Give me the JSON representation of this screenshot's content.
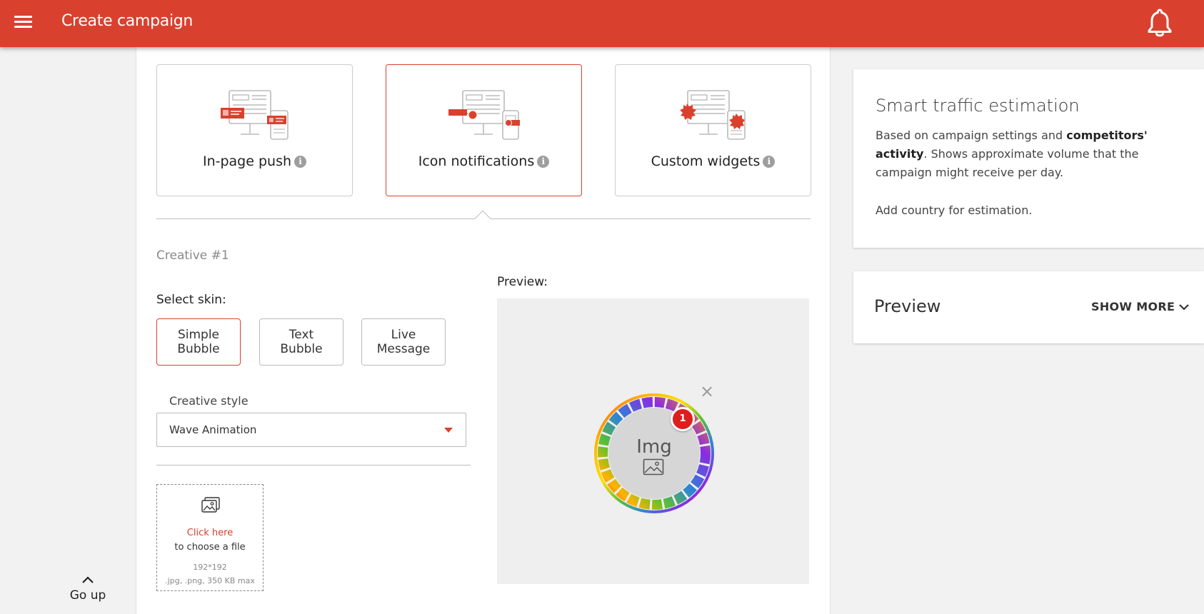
{
  "header": {
    "title": "Create campaign",
    "menu_icon": "hamburger-menu-icon",
    "bell_icon": "bell-icon",
    "color": "#d9412e"
  },
  "ad_types": [
    {
      "label": "In-page push",
      "info_icon": "info-icon",
      "selected": false
    },
    {
      "label": "Icon notifications",
      "info_icon": "info-icon",
      "selected": true
    },
    {
      "label": "Custom widgets",
      "info_icon": "info-icon",
      "selected": false
    }
  ],
  "creative": {
    "title": "Creative #1",
    "skin_label": "Select skin:",
    "skins": [
      {
        "label": "Simple Bubble",
        "selected": true
      },
      {
        "label": "Text Bubble",
        "selected": false
      },
      {
        "label": "Live Message",
        "selected": false
      }
    ],
    "style_label": "Creative style",
    "style_value": "Wave Animation",
    "upload": {
      "click_text": "Click here",
      "choose_text": "to choose a file",
      "dimensions": "192*192",
      "formats": ".jpg, .png, 350 KB max"
    }
  },
  "preview": {
    "label": "Preview:",
    "close_symbol": "×",
    "bubble_text": "Img",
    "badge_count": "1"
  },
  "go_up": {
    "label": "Go up"
  },
  "estimation": {
    "title": "Smart traffic estimation",
    "desc_prefix": "Based on campaign settings and ",
    "desc_bold": "competitors' activity",
    "desc_suffix": ". Shows approximate volume that the campaign might receive per day.",
    "add_country": "Add country for estimation."
  },
  "preview_panel": {
    "title": "Preview",
    "show_more": "SHOW MORE"
  }
}
